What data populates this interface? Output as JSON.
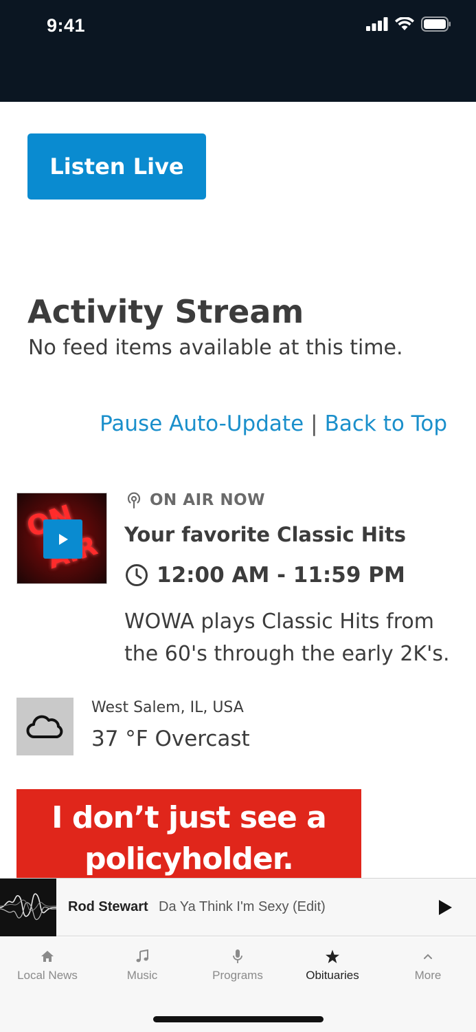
{
  "status_bar": {
    "time": "9:41"
  },
  "listen_live": {
    "label": "Listen Live"
  },
  "activity": {
    "title": "Activity Stream",
    "empty_message": "No feed items available at this time."
  },
  "links": {
    "pause": "Pause Auto-Update",
    "separator": "|",
    "back_to_top": "Back to Top"
  },
  "on_air": {
    "label": "ON AIR NOW",
    "show": "Your favorite Classic Hits",
    "time": "12:00 AM - 11:59 PM",
    "description": "WOWA plays Classic Hits from the 60's through the early 2K's.",
    "thumb_text_1": "ON",
    "thumb_text_2": "AIR"
  },
  "weather": {
    "location": "West Salem, IL, USA",
    "condition": "37 °F Overcast",
    "icon": "cloud-icon"
  },
  "ad": {
    "text": "I don’t just see a policyholder."
  },
  "now_playing": {
    "artist": "Rod Stewart",
    "title": "Da Ya Think I'm Sexy (Edit)"
  },
  "tabs": [
    {
      "label": "Local News",
      "icon": "home-icon"
    },
    {
      "label": "Music",
      "icon": "music-note-icon"
    },
    {
      "label": "Programs",
      "icon": "microphone-icon"
    },
    {
      "label": "Obituaries",
      "icon": "star-icon",
      "active": true
    },
    {
      "label": "More",
      "icon": "chevron-up-icon"
    }
  ],
  "colors": {
    "accent": "#0a8bd0",
    "link": "#1a8fcb",
    "status_bar": "#0b1622",
    "ad": "#e0261b"
  }
}
